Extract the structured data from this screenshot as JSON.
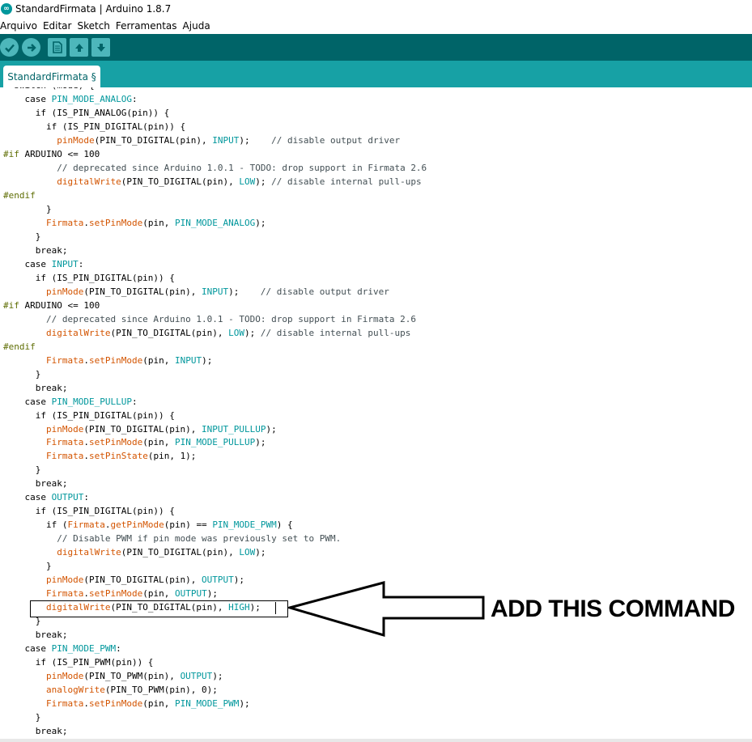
{
  "window": {
    "title": "StandardFirmata | Arduino 1.8.7"
  },
  "menu": [
    "Arquivo",
    "Editar",
    "Sketch",
    "Ferramentas",
    "Ajuda"
  ],
  "toolbar": {
    "icons": [
      "verify-icon",
      "upload-icon",
      "new-icon",
      "open-icon",
      "save-icon"
    ]
  },
  "tab": {
    "label": "StandardFirmata §"
  },
  "colors": {
    "toolbar": "#006468",
    "tabstrip": "#17a1a5",
    "function": "#d35400",
    "constant": "#00979c",
    "preprocessor": "#5e6d03",
    "comment": "#434f54"
  },
  "annotation": {
    "text": "ADD THIS COMMAND"
  },
  "code_lines": [
    [
      [
        "p",
        "  switch (mode) {"
      ]
    ],
    [
      [
        "p",
        "    case "
      ],
      [
        "c",
        "PIN_MODE_ANALOG"
      ],
      [
        "p",
        ":"
      ]
    ],
    [
      [
        "p",
        "      if (IS_PIN_ANALOG(pin)) {"
      ]
    ],
    [
      [
        "p",
        "        if (IS_PIN_DIGITAL(pin)) {"
      ]
    ],
    [
      [
        "p",
        "          "
      ],
      [
        "f",
        "pinMode"
      ],
      [
        "p",
        "(PIN_TO_DIGITAL(pin), "
      ],
      [
        "c",
        "INPUT"
      ],
      [
        "p",
        ");    "
      ],
      [
        "m",
        "// disable output driver"
      ]
    ],
    [
      [
        "x",
        "#if"
      ],
      [
        "p",
        " ARDUINO <= 100"
      ]
    ],
    [
      [
        "m",
        "          // deprecated since Arduino 1.0.1 - TODO: drop support in Firmata 2.6"
      ]
    ],
    [
      [
        "p",
        "          "
      ],
      [
        "f",
        "digitalWrite"
      ],
      [
        "p",
        "(PIN_TO_DIGITAL(pin), "
      ],
      [
        "c",
        "LOW"
      ],
      [
        "p",
        "); "
      ],
      [
        "m",
        "// disable internal pull-ups"
      ]
    ],
    [
      [
        "x",
        "#endif"
      ]
    ],
    [
      [
        "p",
        "        }"
      ]
    ],
    [
      [
        "p",
        "        "
      ],
      [
        "f",
        "Firmata"
      ],
      [
        "p",
        "."
      ],
      [
        "f",
        "setPinMode"
      ],
      [
        "p",
        "(pin, "
      ],
      [
        "c",
        "PIN_MODE_ANALOG"
      ],
      [
        "p",
        ");"
      ]
    ],
    [
      [
        "p",
        "      }"
      ]
    ],
    [
      [
        "p",
        "      break;"
      ]
    ],
    [
      [
        "p",
        "    case "
      ],
      [
        "c",
        "INPUT"
      ],
      [
        "p",
        ":"
      ]
    ],
    [
      [
        "p",
        "      if (IS_PIN_DIGITAL(pin)) {"
      ]
    ],
    [
      [
        "p",
        "        "
      ],
      [
        "f",
        "pinMode"
      ],
      [
        "p",
        "(PIN_TO_DIGITAL(pin), "
      ],
      [
        "c",
        "INPUT"
      ],
      [
        "p",
        ");    "
      ],
      [
        "m",
        "// disable output driver"
      ]
    ],
    [
      [
        "x",
        "#if"
      ],
      [
        "p",
        " ARDUINO <= 100"
      ]
    ],
    [
      [
        "m",
        "        // deprecated since Arduino 1.0.1 - TODO: drop support in Firmata 2.6"
      ]
    ],
    [
      [
        "p",
        "        "
      ],
      [
        "f",
        "digitalWrite"
      ],
      [
        "p",
        "(PIN_TO_DIGITAL(pin), "
      ],
      [
        "c",
        "LOW"
      ],
      [
        "p",
        "); "
      ],
      [
        "m",
        "// disable internal pull-ups"
      ]
    ],
    [
      [
        "x",
        "#endif"
      ]
    ],
    [
      [
        "p",
        "        "
      ],
      [
        "f",
        "Firmata"
      ],
      [
        "p",
        "."
      ],
      [
        "f",
        "setPinMode"
      ],
      [
        "p",
        "(pin, "
      ],
      [
        "c",
        "INPUT"
      ],
      [
        "p",
        ");"
      ]
    ],
    [
      [
        "p",
        "      }"
      ]
    ],
    [
      [
        "p",
        "      break;"
      ]
    ],
    [
      [
        "p",
        "    case "
      ],
      [
        "c",
        "PIN_MODE_PULLUP"
      ],
      [
        "p",
        ":"
      ]
    ],
    [
      [
        "p",
        "      if (IS_PIN_DIGITAL(pin)) {"
      ]
    ],
    [
      [
        "p",
        "        "
      ],
      [
        "f",
        "pinMode"
      ],
      [
        "p",
        "(PIN_TO_DIGITAL(pin), "
      ],
      [
        "c",
        "INPUT_PULLUP"
      ],
      [
        "p",
        ");"
      ]
    ],
    [
      [
        "p",
        "        "
      ],
      [
        "f",
        "Firmata"
      ],
      [
        "p",
        "."
      ],
      [
        "f",
        "setPinMode"
      ],
      [
        "p",
        "(pin, "
      ],
      [
        "c",
        "PIN_MODE_PULLUP"
      ],
      [
        "p",
        ");"
      ]
    ],
    [
      [
        "p",
        "        "
      ],
      [
        "f",
        "Firmata"
      ],
      [
        "p",
        "."
      ],
      [
        "f",
        "setPinState"
      ],
      [
        "p",
        "(pin, 1);"
      ]
    ],
    [
      [
        "p",
        "      }"
      ]
    ],
    [
      [
        "p",
        "      break;"
      ]
    ],
    [
      [
        "p",
        "    case "
      ],
      [
        "c",
        "OUTPUT"
      ],
      [
        "p",
        ":"
      ]
    ],
    [
      [
        "p",
        "      if (IS_PIN_DIGITAL(pin)) {"
      ]
    ],
    [
      [
        "p",
        "        if ("
      ],
      [
        "f",
        "Firmata"
      ],
      [
        "p",
        "."
      ],
      [
        "f",
        "getPinMode"
      ],
      [
        "p",
        "(pin) == "
      ],
      [
        "c",
        "PIN_MODE_PWM"
      ],
      [
        "p",
        ") {"
      ]
    ],
    [
      [
        "m",
        "          // Disable PWM if pin mode was previously set to PWM."
      ]
    ],
    [
      [
        "p",
        "          "
      ],
      [
        "f",
        "digitalWrite"
      ],
      [
        "p",
        "(PIN_TO_DIGITAL(pin), "
      ],
      [
        "c",
        "LOW"
      ],
      [
        "p",
        ");"
      ]
    ],
    [
      [
        "p",
        "        }"
      ]
    ],
    [
      [
        "p",
        "        "
      ],
      [
        "f",
        "pinMode"
      ],
      [
        "p",
        "(PIN_TO_DIGITAL(pin), "
      ],
      [
        "c",
        "OUTPUT"
      ],
      [
        "p",
        ");"
      ]
    ],
    [
      [
        "p",
        "        "
      ],
      [
        "f",
        "Firmata"
      ],
      [
        "p",
        "."
      ],
      [
        "f",
        "setPinMode"
      ],
      [
        "p",
        "(pin, "
      ],
      [
        "c",
        "OUTPUT"
      ],
      [
        "p",
        ");"
      ]
    ],
    [
      [
        "p",
        "        "
      ],
      [
        "f",
        "digitalWrite"
      ],
      [
        "p",
        "(PIN_TO_DIGITAL(pin), "
      ],
      [
        "c",
        "HIGH"
      ],
      [
        "p",
        ");"
      ]
    ],
    [
      [
        "p",
        "      }"
      ]
    ],
    [
      [
        "p",
        "      break;"
      ]
    ],
    [
      [
        "p",
        "    case "
      ],
      [
        "c",
        "PIN_MODE_PWM"
      ],
      [
        "p",
        ":"
      ]
    ],
    [
      [
        "p",
        "      if (IS_PIN_PWM(pin)) {"
      ]
    ],
    [
      [
        "p",
        "        "
      ],
      [
        "f",
        "pinMode"
      ],
      [
        "p",
        "(PIN_TO_PWM(pin), "
      ],
      [
        "c",
        "OUTPUT"
      ],
      [
        "p",
        ");"
      ]
    ],
    [
      [
        "p",
        "        "
      ],
      [
        "f",
        "analogWrite"
      ],
      [
        "p",
        "(PIN_TO_PWM(pin), 0);"
      ]
    ],
    [
      [
        "p",
        "        "
      ],
      [
        "f",
        "Firmata"
      ],
      [
        "p",
        "."
      ],
      [
        "f",
        "setPinMode"
      ],
      [
        "p",
        "(pin, "
      ],
      [
        "c",
        "PIN_MODE_PWM"
      ],
      [
        "p",
        ");"
      ]
    ],
    [
      [
        "p",
        "      }"
      ]
    ],
    [
      [
        "p",
        "      break;"
      ]
    ]
  ]
}
